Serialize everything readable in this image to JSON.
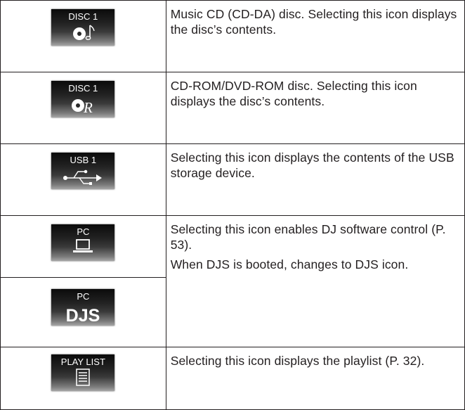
{
  "rows": [
    {
      "icon": {
        "label": "DISC 1",
        "glyph": "music-cd-icon"
      },
      "description": [
        "Music CD (CD-DA) disc. Selecting this icon displays the disc’s contents."
      ]
    },
    {
      "icon": {
        "label": "DISC 1",
        "glyph": "data-disc-icon"
      },
      "description": [
        "CD-ROM/DVD-ROM disc. Selecting this icon displays the disc’s contents."
      ]
    },
    {
      "icon": {
        "label": "USB 1",
        "glyph": "usb-icon"
      },
      "description": [
        "Selecting this icon displays the contents of the USB storage device."
      ]
    },
    {
      "icons": [
        {
          "label": "PC",
          "glyph": "computer-icon"
        },
        {
          "label": "PC",
          "glyph": "djs-icon",
          "logo_text": "DJS"
        }
      ],
      "description": [
        "Selecting this icon enables DJ software control (P. 53).",
        "When DJS is booted, changes to DJS icon."
      ]
    },
    {
      "icon": {
        "label": "PLAY LIST",
        "glyph": "playlist-icon"
      },
      "description": [
        "Selecting this icon displays the playlist (P. 32)."
      ]
    }
  ]
}
